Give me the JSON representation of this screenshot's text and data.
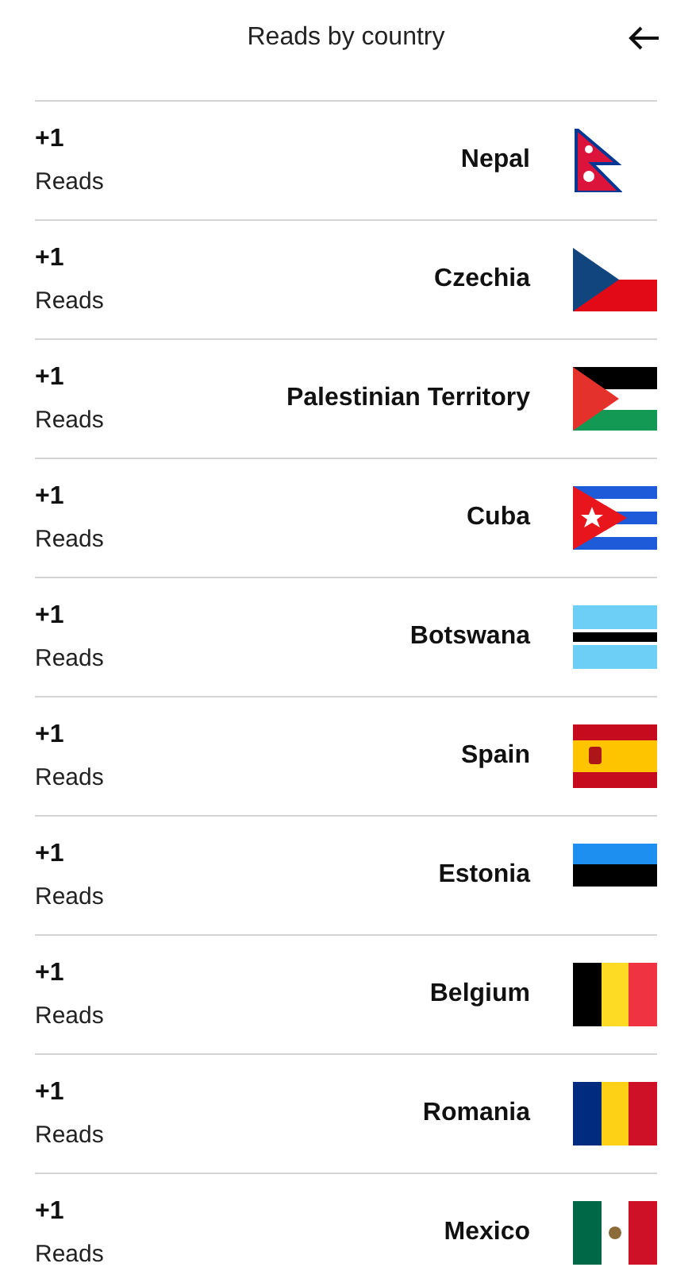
{
  "header": {
    "title": "Reads by country"
  },
  "rows": [
    {
      "count": "+1",
      "label": "Reads",
      "country": "Nepal",
      "kind": "nepal"
    },
    {
      "count": "+1",
      "label": "Reads",
      "country": "Czechia",
      "kind": "czechia"
    },
    {
      "count": "+1",
      "label": "Reads",
      "country": "Palestinian Territory",
      "kind": "palestine"
    },
    {
      "count": "+1",
      "label": "Reads",
      "country": "Cuba",
      "kind": "cuba"
    },
    {
      "count": "+1",
      "label": "Reads",
      "country": "Botswana",
      "kind": "botswana"
    },
    {
      "count": "+1",
      "label": "Reads",
      "country": "Spain",
      "kind": "spain"
    },
    {
      "count": "+1",
      "label": "Reads",
      "country": "Estonia",
      "kind": "estonia"
    },
    {
      "count": "+1",
      "label": "Reads",
      "country": "Belgium",
      "kind": "belgium"
    },
    {
      "count": "+1",
      "label": "Reads",
      "country": "Romania",
      "kind": "romania"
    },
    {
      "count": "+1",
      "label": "Reads",
      "country": "Mexico",
      "kind": "mexico"
    }
  ]
}
